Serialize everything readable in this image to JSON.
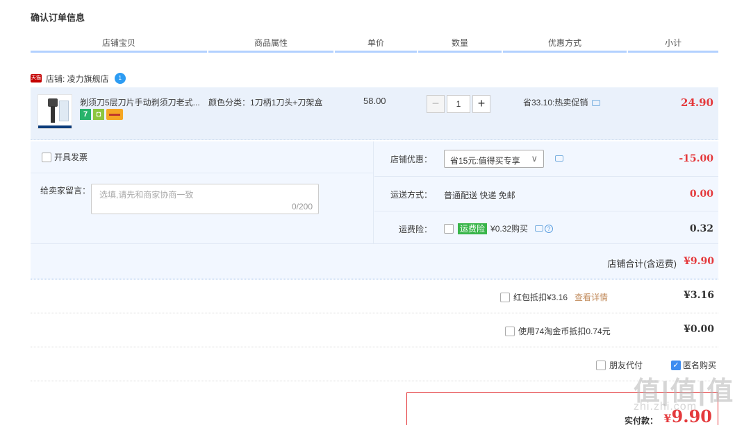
{
  "page": {
    "title": "确认订单信息"
  },
  "columns": [
    "店铺宝贝",
    "商品属性",
    "单价",
    "数量",
    "优惠方式",
    "小计"
  ],
  "shop": {
    "badge": "天猫",
    "label": "店铺: 凌力旗舰店",
    "wangwang_badge": "1"
  },
  "item": {
    "title": "剃须刀5层刀片手动剃须刀老式...",
    "badge_seven": "7",
    "attr": "颜色分类：1刀柄1刀头+刀架盒",
    "price": "58.00",
    "qty_minus": "−",
    "quantity": "1",
    "qty_plus": "+",
    "promo": "省33.10:热卖促销",
    "subtotal": "24.90"
  },
  "invoice_label": "开具发票",
  "message": {
    "label": "给卖家留言：",
    "placeholder": "选填,请先和商家协商一致",
    "counter": "0/200"
  },
  "store_discount": {
    "label": "店铺优惠：",
    "selected": "省15元:值得买专享",
    "amount": "-15.00",
    "color": "#e4393c"
  },
  "shipping": {
    "label": "运送方式：",
    "value": "普通配送 快递 免邮",
    "amount": "0.00",
    "color": "#e4393c"
  },
  "insurance": {
    "label": "运费险：",
    "tag": "运费险",
    "price": "¥0.32购买",
    "help": "?",
    "amount": "0.32"
  },
  "shop_total": {
    "label": "店铺合计(含运费)",
    "amount": "¥9.90"
  },
  "redpacket": {
    "label": "红包抵扣¥3.16",
    "link": "查看详情",
    "amount": "¥3.16"
  },
  "taobao_coins": {
    "label": "使用74淘金币抵扣0.74元",
    "amount": "¥0.00"
  },
  "friend_pay": {
    "label": "朋友代付"
  },
  "anonymous": {
    "label": "匿名购买",
    "checked": true
  },
  "payment": {
    "label": "实付款：",
    "currency": "¥",
    "amount": "9.90"
  },
  "watermark": {
    "main": "值|值|值",
    "sub": "zhi.zhi.com"
  },
  "colors": {
    "accent_red": "#e4393c",
    "header_line": "#b2d1ff",
    "row_bg": "#eaf1fb",
    "panel_bg": "#f2f7ff"
  }
}
